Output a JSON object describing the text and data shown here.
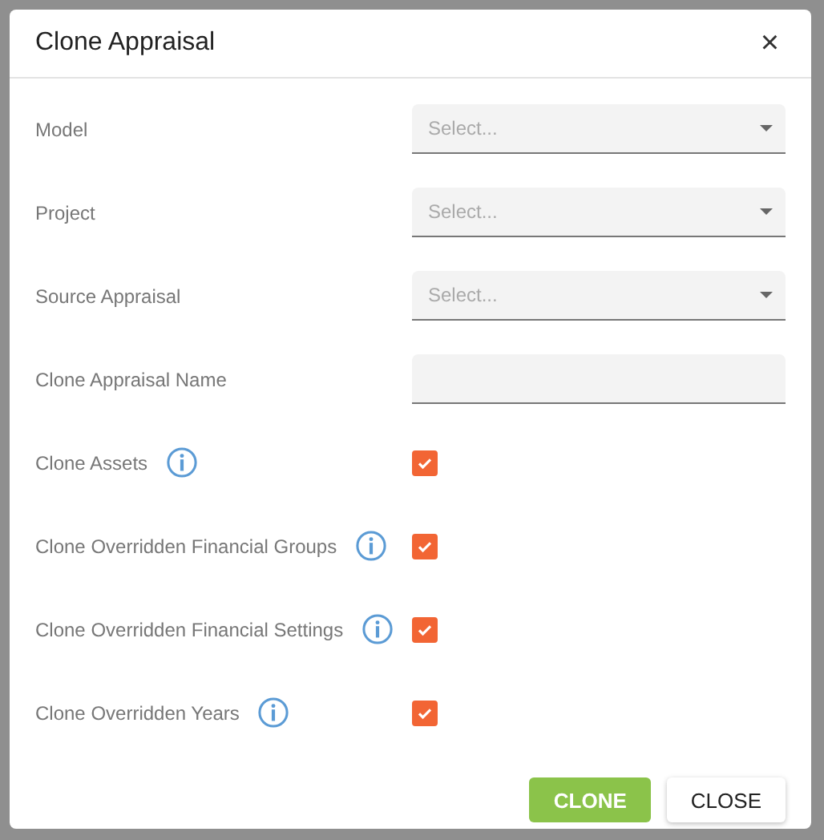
{
  "dialog": {
    "title": "Clone Appraisal",
    "close_icon": "×"
  },
  "fields": [
    {
      "kind": "select",
      "label": "Model",
      "placeholder": "Select..."
    },
    {
      "kind": "select",
      "label": "Project",
      "placeholder": "Select..."
    },
    {
      "kind": "select",
      "label": "Source Appraisal",
      "placeholder": "Select..."
    },
    {
      "kind": "text",
      "label": "Clone Appraisal Name"
    },
    {
      "kind": "checkbox",
      "label": "Clone Assets",
      "checked": true
    },
    {
      "kind": "checkbox",
      "label": "Clone Overridden Financial Groups",
      "checked": true
    },
    {
      "kind": "checkbox",
      "label": "Clone Overridden Financial Settings",
      "checked": true
    },
    {
      "kind": "checkbox",
      "label": "Clone Overridden Years",
      "checked": true
    }
  ],
  "buttons": [
    {
      "label": "CLONE",
      "kind": "primary"
    },
    {
      "label": "CLOSE",
      "kind": "secondary"
    }
  ]
}
